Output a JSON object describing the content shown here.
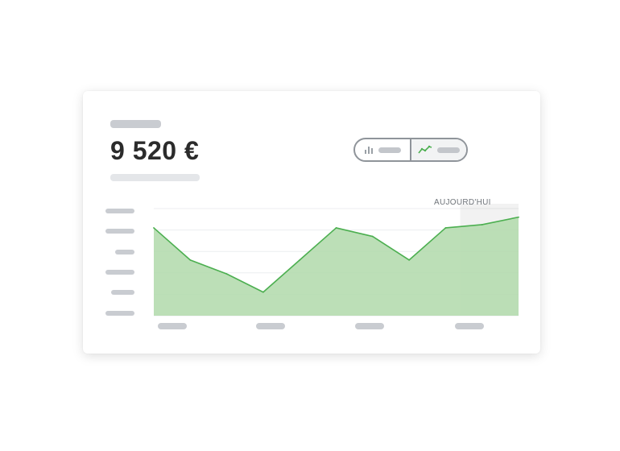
{
  "summary": {
    "amount": "9 520 €"
  },
  "view_toggle": {
    "options": [
      {
        "icon": "bar-chart-icon",
        "active": false
      },
      {
        "icon": "line-chart-icon",
        "active": true
      }
    ]
  },
  "chart_data": {
    "type": "area",
    "x": [
      0,
      1,
      2,
      3,
      4,
      5,
      6,
      7,
      8,
      9,
      10
    ],
    "values": [
      82,
      52,
      39,
      22,
      52,
      82,
      74,
      52,
      82,
      85,
      92
    ],
    "ylim": [
      0,
      100
    ],
    "grid": true,
    "annotations": [
      {
        "text": "AUJOURD'HUI",
        "x_range": [
          8.4,
          10
        ]
      }
    ],
    "colors": {
      "line": "#4caf50",
      "fill": "#b5dcaf",
      "highlight": "#000000",
      "grid": "#eceef0"
    }
  }
}
